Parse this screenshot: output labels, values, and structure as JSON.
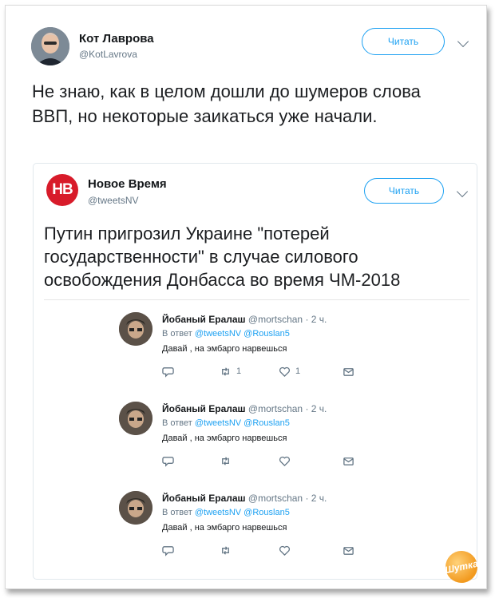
{
  "tweet": {
    "author_name": "Кот Лаврова",
    "author_handle": "@KotLavrova",
    "follow_label": "Читать",
    "text": "Не знаю, как в целом дошли до шумеров слова ВВП, но некоторые заикаться уже начали."
  },
  "quoted": {
    "logo_text": "НВ",
    "author_name": "Новое Время",
    "author_handle": "@tweetsNV",
    "follow_label": "Читать",
    "text": "Путин пригрозил Украине \"потерей государственности\" в случае силового освобождения Донбасса во время ЧМ-2018"
  },
  "replies": [
    {
      "name": "Йобаный Ералаш",
      "meta": "@mortschan · 2 ч.",
      "reply_prefix": "В ответ",
      "mentions": "@tweetsNV @Rouslan5",
      "text": "Давай , на эмбарго нарвешься",
      "retweets": "1",
      "likes": "1"
    },
    {
      "name": "Йобаный Ералаш",
      "meta": "@mortschan · 2 ч.",
      "reply_prefix": "В ответ",
      "mentions": "@tweetsNV @Rouslan5",
      "text": "Давай , на эмбарго нарвешься",
      "retweets": "",
      "likes": ""
    },
    {
      "name": "Йобаный Ералаш",
      "meta": "@mortschan · 2 ч.",
      "reply_prefix": "В ответ",
      "mentions": "@tweetsNV @Rouslan5",
      "text": "Давай , на эмбарго нарвешься",
      "retweets": "",
      "likes": ""
    }
  ],
  "watermark": "Шутка",
  "colors": {
    "accent": "#1da1f2",
    "nv_brand": "#d81b2a",
    "muted": "#657786"
  },
  "icons": [
    "reply-icon",
    "retweet-icon",
    "heart-icon",
    "message-icon",
    "chevron-down-icon"
  ]
}
